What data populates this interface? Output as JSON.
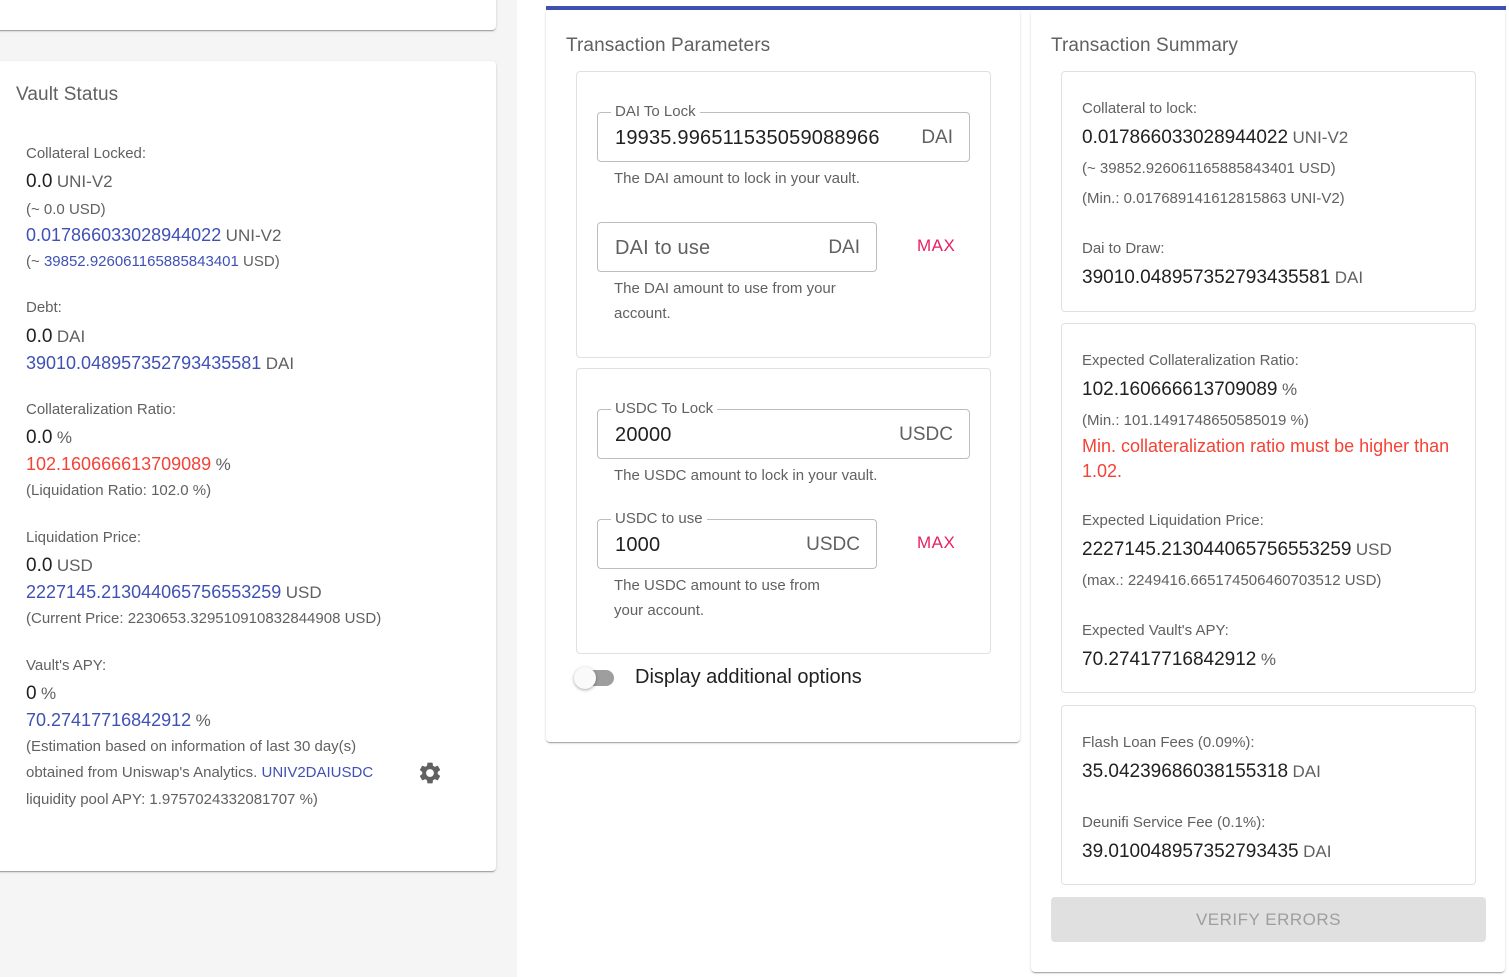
{
  "vault_status": {
    "title": "Vault Status",
    "collateral": {
      "label": "Collateral Locked:",
      "current_value": "0.0",
      "current_unit": "UNI-V2",
      "current_usd": "(~ 0.0 USD)",
      "new_value": "0.017866033028944022",
      "new_unit": "UNI-V2",
      "new_usd_prefix": "(~ ",
      "new_usd_value": "39852.926061165885843401",
      "new_usd_suffix": " USD)"
    },
    "debt": {
      "label": "Debt:",
      "current_value": "0.0",
      "current_unit": "DAI",
      "new_value": "39010.048957352793435581",
      "new_unit": "DAI"
    },
    "ratio": {
      "label": "Collateralization Ratio:",
      "current_value": "0.0",
      "current_unit": "%",
      "new_value": "102.160666613709089",
      "new_unit": "%",
      "note": "(Liquidation Ratio: 102.0 %)"
    },
    "liquidation_price": {
      "label": "Liquidation Price:",
      "current_value": "0.0",
      "current_unit": "USD",
      "new_value": "2227145.213044065756553259",
      "new_unit": "USD",
      "note": "(Current Price: 2230653.329510910832844908 USD)"
    },
    "apy": {
      "label": "Vault's APY:",
      "current_value": "0",
      "current_unit": "%",
      "new_value": "70.27417716842912",
      "new_unit": "%",
      "note_line1": "(Estimation based on information of last 30 day(s)",
      "note_line2_prefix": "obtained from Uniswap's Analytics. ",
      "note_link": "UNIV2DAIUSDC",
      "note_line3": "liquidity pool APY: 1.9757024332081707 %)",
      "settings_icon": "gear-icon"
    }
  },
  "transaction_parameters": {
    "title": "Transaction Parameters",
    "dai_to_lock": {
      "label": "DAI To Lock",
      "value": "19935.996511535059088966",
      "adornment": "DAI",
      "helper": "The DAI amount to lock in your vault."
    },
    "dai_to_use": {
      "placeholder": "DAI to use",
      "value": "",
      "adornment": "DAI",
      "helper_line1": "The DAI amount to use from your",
      "helper_line2": "account.",
      "max_label": "MAX"
    },
    "usdc_to_lock": {
      "label": "USDC To Lock",
      "value": "20000",
      "adornment": "USDC",
      "helper": "The USDC amount to lock in your vault."
    },
    "usdc_to_use": {
      "label": "USDC to use",
      "value": "1000",
      "adornment": "USDC",
      "helper_line1": "The USDC amount to use from",
      "helper_line2": "your account.",
      "max_label": "MAX"
    },
    "additional_options": {
      "label": "Display additional options",
      "enabled": false
    }
  },
  "transaction_summary": {
    "title": "Transaction Summary",
    "collateral": {
      "label": "Collateral to lock:",
      "value": "0.017866033028944022",
      "unit": "UNI-V2",
      "usd": "(~ 39852.926061165885843401 USD)",
      "min": "(Min.: 0.017689141612815863 UNI-V2)"
    },
    "draw": {
      "label": "Dai to Draw:",
      "value": "39010.048957352793435581",
      "unit": "DAI"
    },
    "expected_ratio": {
      "label": "Expected Collateralization Ratio:",
      "value": "102.160666613709089",
      "unit": "%",
      "min": "(Min.: 101.1491748650585019 %)",
      "error_line1": "Min. collateralization ratio must be higher than",
      "error_line2": "1.02."
    },
    "expected_liquidation": {
      "label": "Expected Liquidation Price:",
      "value": "2227145.213044065756553259",
      "unit": "USD",
      "max": "(max.: 2249416.665174506460703512 USD)"
    },
    "expected_apy": {
      "label": "Expected Vault's APY:",
      "value": "70.27417716842912",
      "unit": "%"
    },
    "flash_fees": {
      "label": "Flash Loan Fees (0.09%):",
      "value": "35.04239686038155318",
      "unit": "DAI"
    },
    "service_fee": {
      "label": "Deunifi Service Fee (0.1%):",
      "value": "39.010048957352793435",
      "unit": "DAI"
    },
    "verify_button": "VERIFY ERRORS"
  },
  "colors": {
    "accent_blue": "#3f51b5",
    "error_red": "#f44336",
    "max_pink": "#e91e63"
  }
}
